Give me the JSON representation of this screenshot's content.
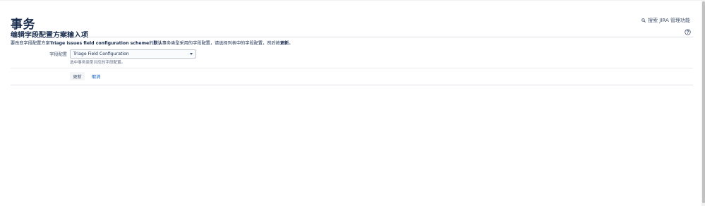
{
  "page": {
    "title": "事务"
  },
  "admin_search": {
    "label": "搜索 JIRA 管理功能",
    "icon": "search-icon"
  },
  "section": {
    "title": "编辑字段配置方案输入项",
    "help_icon": "help-icon"
  },
  "description": {
    "prefix": "要改变字段配置方案",
    "scheme_name": "Triage issues field configuration scheme",
    "middle_1": "的",
    "default_word": "默认",
    "middle_2": "事务类型采用的字段配置，请选择列表中的字段配置，然后按",
    "update_word": "更新",
    "suffix": "。"
  },
  "form": {
    "field_label": "字段配置",
    "select_value": "Triage Field Configuration",
    "hint": "选中事务类型对应的字段配置。",
    "update_button": "更新",
    "cancel_link": "取消"
  },
  "colors": {
    "text": "#172b4d",
    "link": "#0052cc",
    "muted": "#5e6c84",
    "border": "#dfe1e6"
  }
}
